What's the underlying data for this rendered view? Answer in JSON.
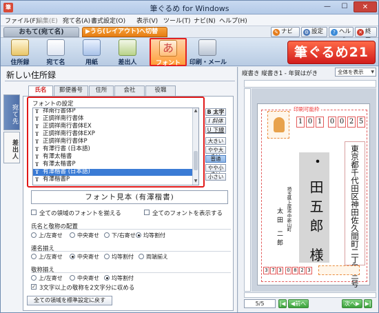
{
  "window": {
    "title": "筆ぐるめ for Windows",
    "app_icon": "筆",
    "min": "—",
    "max": "☐",
    "close": "✕"
  },
  "menu": [
    "ファイル(F)",
    "編集(E)",
    "宛て名(A)",
    "書式設定(O)",
    "表示(V)",
    "ツール(T)",
    "ナビ(N)",
    "ヘルプ(H)"
  ],
  "mode": {
    "omote": "おもて(宛て名)",
    "ura": "うら(レイアウト)へ切替",
    "navi": "ナビ",
    "setting": "設定",
    "help": "ヘルプ",
    "exit": "終了"
  },
  "toolbar": {
    "items": [
      "住所録",
      "宛て名",
      "用紙",
      "差出人",
      "フォント",
      "印刷・メール"
    ],
    "brand": "筆ぐるめ21"
  },
  "panel": {
    "title": "新しい住所録",
    "side_tabs": [
      "宛て先",
      "差出人"
    ],
    "tabs": [
      "氏名",
      "郵便番号",
      "住所",
      "会社",
      "役職"
    ]
  },
  "font_settings": {
    "label": "フォントの設定",
    "fonts": [
      "祥南行書体P",
      "正調祥南行書体",
      "正調祥南行書体EX",
      "正調祥南行書体EXP",
      "正調祥南行書体P",
      "有澤行書 (日本語)",
      "有澤太楷書",
      "有澤太楷書P",
      "有澤楷書 (日本語)",
      "有澤楷書P"
    ],
    "selected_index": 8,
    "style_buttons": [
      "B 太字",
      "I 斜体",
      "U 下線"
    ],
    "size_buttons": [
      "大きい",
      "やや大きい",
      "普通",
      "やや小さい",
      "小さい"
    ],
    "active_size": 2,
    "preview": "フォント見本 (有澤楷書)",
    "checkbox_all_fields": "全ての領域のフォントを揃える",
    "checkbox_show_all": "全てのフォントを表示する"
  },
  "name_title_layout": {
    "label": "氏名と敬称の配置",
    "options": [
      "上/左寄せ",
      "中央寄せ",
      "下/右寄せ",
      "均等割付"
    ],
    "selected": 3
  },
  "joint_names": {
    "label": "連名揃え",
    "options": [
      "上/左寄せ",
      "中央寄せ",
      "均等割付",
      "両端揃え"
    ],
    "selected": 1
  },
  "honorific": {
    "label": "敬称揃え",
    "options": [
      "上/左寄せ",
      "中央寄せ",
      "均等割付"
    ],
    "selected": 2,
    "checkbox": "3文字以上の敬称を2文字分に収める",
    "checkbox_checked": true
  },
  "reset_button": "全ての領域を標準設定に戻す",
  "preview": {
    "title": "縦書き 縦書き1 - 年賀はがき",
    "zoom": "全体を表示",
    "printable": "印刷可能枠",
    "zip": [
      "1",
      "0",
      "1",
      "0",
      "0",
      "2",
      "5"
    ],
    "address": "東京都千代田区神田佐久間町二丁目三号",
    "name": "田五郎 様",
    "name_top": "・",
    "sender_address": "埼玉県上尾市中新山町",
    "sender_name": "太田 二郎",
    "sender_zip": [
      "3",
      "7",
      "3",
      "0",
      "8",
      "2",
      "3"
    ],
    "page": "5/5",
    "prev": "前へ",
    "next": "次へ"
  }
}
